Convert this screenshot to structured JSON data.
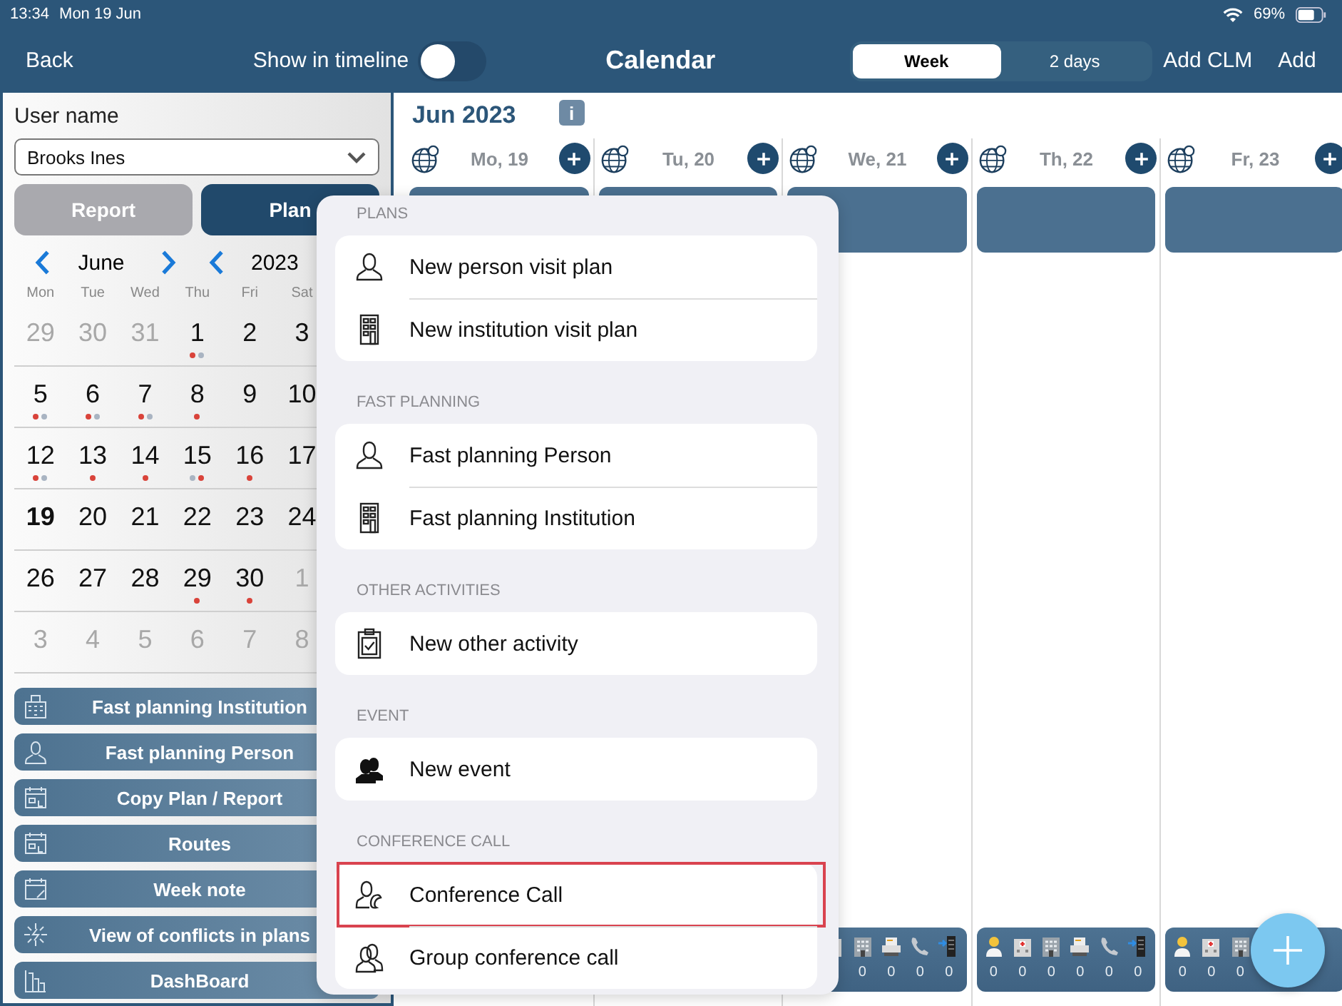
{
  "status_bar": {
    "time": "13:34",
    "date": "Mon 19 Jun",
    "battery": "69%"
  },
  "nav": {
    "back": "Back",
    "timeline_label": "Show in timeline",
    "timeline_on": false,
    "title": "Calendar",
    "views": [
      {
        "label": "Week",
        "selected": true
      },
      {
        "label": "2 days",
        "selected": false
      }
    ],
    "actions": [
      "Add CLM",
      "Add"
    ]
  },
  "sidebar": {
    "user_label": "User name",
    "user_value": "Brooks Ines",
    "modes": [
      {
        "label": "Report",
        "selected": false
      },
      {
        "label": "Plan",
        "selected": true
      }
    ],
    "month": "June",
    "year": "2023",
    "weekdays": [
      "Mon",
      "Tue",
      "Wed",
      "Thu",
      "Fri",
      "Sat"
    ],
    "weeks": [
      [
        {
          "day": "29",
          "in_month": false,
          "selected": false
        },
        {
          "day": "30",
          "in_month": false,
          "selected": false
        },
        {
          "day": "31",
          "in_month": false,
          "selected": false
        },
        {
          "day": "1",
          "in_month": true,
          "selected": false,
          "dots": [
            {
              "color": "#d9433a"
            },
            {
              "color": "#a9b4c2"
            }
          ]
        },
        {
          "day": "2",
          "in_month": true,
          "selected": false
        },
        {
          "day": "3",
          "in_month": true,
          "selected": false
        }
      ],
      [
        {
          "day": "5",
          "in_month": true,
          "selected": false,
          "dots": [
            {
              "color": "#d9433a"
            },
            {
              "color": "#a9b4c2"
            }
          ]
        },
        {
          "day": "6",
          "in_month": true,
          "selected": false,
          "dots": [
            {
              "color": "#d9433a"
            },
            {
              "color": "#a9b4c2"
            }
          ]
        },
        {
          "day": "7",
          "in_month": true,
          "selected": false,
          "dots": [
            {
              "color": "#d9433a"
            },
            {
              "color": "#a9b4c2"
            }
          ]
        },
        {
          "day": "8",
          "in_month": true,
          "selected": false,
          "dots": [
            {
              "color": "#d9433a"
            }
          ]
        },
        {
          "day": "9",
          "in_month": true,
          "selected": false
        },
        {
          "day": "10",
          "in_month": true,
          "selected": false
        }
      ],
      [
        {
          "day": "12",
          "in_month": true,
          "selected": false,
          "dots": [
            {
              "color": "#d9433a"
            },
            {
              "color": "#a9b4c2"
            }
          ]
        },
        {
          "day": "13",
          "in_month": true,
          "selected": false,
          "dots": [
            {
              "color": "#d9433a"
            }
          ]
        },
        {
          "day": "14",
          "in_month": true,
          "selected": false,
          "dots": [
            {
              "color": "#d9433a"
            }
          ]
        },
        {
          "day": "15",
          "in_month": true,
          "selected": false,
          "dots": [
            {
              "color": "#a9b4c2"
            },
            {
              "color": "#d9433a"
            }
          ]
        },
        {
          "day": "16",
          "in_month": true,
          "selected": false,
          "dots": [
            {
              "color": "#d9433a"
            }
          ]
        },
        {
          "day": "17",
          "in_month": true,
          "selected": false
        }
      ],
      [
        {
          "day": "19",
          "in_month": true,
          "selected": true
        },
        {
          "day": "20",
          "in_month": true,
          "selected": false
        },
        {
          "day": "21",
          "in_month": true,
          "selected": false
        },
        {
          "day": "22",
          "in_month": true,
          "selected": false
        },
        {
          "day": "23",
          "in_month": true,
          "selected": false
        },
        {
          "day": "24",
          "in_month": true,
          "selected": false
        }
      ],
      [
        {
          "day": "26",
          "in_month": true,
          "selected": false
        },
        {
          "day": "27",
          "in_month": true,
          "selected": false
        },
        {
          "day": "28",
          "in_month": true,
          "selected": false
        },
        {
          "day": "29",
          "in_month": true,
          "selected": false,
          "dots": [
            {
              "color": "#d9433a"
            }
          ]
        },
        {
          "day": "30",
          "in_month": true,
          "selected": false,
          "dots": [
            {
              "color": "#d9433a"
            }
          ]
        },
        {
          "day": "1",
          "in_month": false,
          "selected": false
        }
      ],
      [
        {
          "day": "3",
          "in_month": false,
          "selected": false
        },
        {
          "day": "4",
          "in_month": false,
          "selected": false
        },
        {
          "day": "5",
          "in_month": false,
          "selected": false
        },
        {
          "day": "6",
          "in_month": false,
          "selected": false
        },
        {
          "day": "7",
          "in_month": false,
          "selected": false
        },
        {
          "day": "8",
          "in_month": false,
          "selected": false
        }
      ]
    ],
    "shortcuts": [
      {
        "label": "Fast planning Institution",
        "kind": "institution"
      },
      {
        "label": "Fast planning Person",
        "kind": "person"
      },
      {
        "label": "Copy Plan / Report",
        "kind": "calendar"
      },
      {
        "label": "Routes",
        "kind": "calendar"
      },
      {
        "label": "Week note",
        "kind": "note"
      },
      {
        "label": "View of conflicts in plans",
        "kind": "conflicts"
      },
      {
        "label": "DashBoard",
        "kind": "dashboard"
      }
    ]
  },
  "calendar": {
    "title": "Jun 2023",
    "info": "i",
    "days": [
      {
        "label": "Mo, 19"
      },
      {
        "label": "Tu, 20"
      },
      {
        "label": "We, 21",
        "summary": [
          {
            "kind": "hospital"
          },
          {
            "kind": "building",
            "count": "0"
          },
          {
            "kind": "fax",
            "count": "0"
          },
          {
            "kind": "phone",
            "count": "0"
          },
          {
            "kind": "tower",
            "count": "0"
          }
        ]
      },
      {
        "label": "Th, 22",
        "summary": [
          {
            "kind": "doctor",
            "count": "0"
          },
          {
            "kind": "hospital",
            "count": "0"
          },
          {
            "kind": "building",
            "count": "0"
          },
          {
            "kind": "fax",
            "count": "0"
          },
          {
            "kind": "phone",
            "count": "0"
          },
          {
            "kind": "tower",
            "count": "0"
          }
        ]
      },
      {
        "label": "Fr, 23",
        "summary": [
          {
            "kind": "doctor",
            "count": "0"
          },
          {
            "kind": "hospital",
            "count": "0"
          },
          {
            "kind": "building",
            "count": "0"
          }
        ]
      }
    ]
  },
  "menu": {
    "sections": [
      {
        "title": "PLANS",
        "items": [
          {
            "label": "New person visit plan",
            "kind": "person",
            "highlighted": false
          },
          {
            "label": "New institution visit plan",
            "kind": "building",
            "highlighted": false
          }
        ]
      },
      {
        "title": "FAST PLANNING",
        "items": [
          {
            "label": "Fast planning Person",
            "kind": "person",
            "highlighted": false
          },
          {
            "label": "Fast planning Institution",
            "kind": "building",
            "highlighted": false
          }
        ]
      },
      {
        "title": "OTHER ACTIVITIES",
        "items": [
          {
            "label": "New other activity",
            "kind": "clipboard",
            "highlighted": false
          }
        ]
      },
      {
        "title": "EVENT",
        "items": [
          {
            "label": "New event",
            "kind": "group",
            "highlighted": false
          }
        ]
      },
      {
        "title": "CONFERENCE CALL",
        "items": [
          {
            "label": "Conference Call",
            "kind": "caller",
            "highlighted": true
          },
          {
            "label": "Group conference call",
            "kind": "people",
            "highlighted": false
          }
        ]
      }
    ]
  }
}
